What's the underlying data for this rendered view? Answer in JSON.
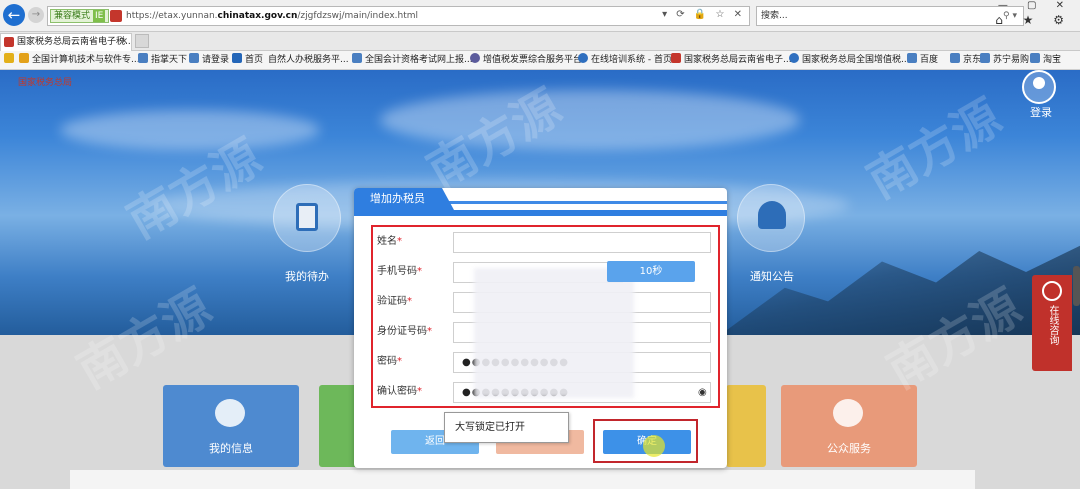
{
  "browser": {
    "mode_label": "兼容模式",
    "mode_badge": "IE",
    "url_prefix": "https://etax.yunnan.",
    "url_domain": "chinatax.gov.cn",
    "url_path": "/zjgfdzswj/main/index.html",
    "url_icons": "▾ ⟳ 🔒 ☆ ✕",
    "search_placeholder": "搜索...",
    "search_icon": "magnifier-icon",
    "window_controls": "—  ▢  ✕",
    "toolbar_icons": "⌂ ★ ⚙",
    "tab_title": "国家税务总局云南省电子税...",
    "tab_close": "✕"
  },
  "favorites": [
    {
      "label": "全国计算机技术与软件专...",
      "color": "#e3a11a"
    },
    {
      "label": "指掌天下",
      "color": "#4a7fc1"
    },
    {
      "label": "请登录",
      "color": "#4a7fc1"
    },
    {
      "label": "首页",
      "color": "#2466b8"
    },
    {
      "label": "自然人办税服务平...",
      "color": "#ffffff"
    },
    {
      "label": "全国会计资格考试网上报...",
      "color": "#4a7fc1"
    },
    {
      "label": "增值税发票综合服务平台",
      "color": "#5b5b9c"
    },
    {
      "label": "在线培训系统 - 首页",
      "color": "#2f6fbf"
    },
    {
      "label": "国家税务总局云南省电子...",
      "color": "#c4362c"
    },
    {
      "label": "国家税务总局全国增值税...",
      "color": "#2f6fbf"
    },
    {
      "label": "百度",
      "color": "#4a7fc1"
    },
    {
      "label": "京东",
      "color": "#4a7fc1"
    },
    {
      "label": "苏宁易购",
      "color": "#4a7fc1"
    },
    {
      "label": "淘宝",
      "color": "#4a7fc1"
    }
  ],
  "page": {
    "logo_text": "国家税务总局",
    "login_label": "登录",
    "my_todo": "我的待办",
    "notice": "通知公告",
    "tiles": [
      {
        "label": "我的信息",
        "color": "#4e8ad0"
      },
      {
        "label": "",
        "color": "#6db85a"
      },
      {
        "label": "",
        "color": "#e8c24a"
      },
      {
        "label": "公众服务",
        "color": "#e89a7a"
      }
    ],
    "online_service": "在线咨询",
    "watermark": "南方源"
  },
  "modal": {
    "title": "增加办税员",
    "fields": [
      {
        "label": "姓名",
        "value": ""
      },
      {
        "label": "手机号码",
        "value": ""
      },
      {
        "label": "验证码",
        "value": ""
      },
      {
        "label": "身份证号码",
        "value": ""
      },
      {
        "label": "密码",
        "value": "●●●●●●●●●●●"
      },
      {
        "label": "确认密码",
        "value": "●●●●●●●●●●●"
      }
    ],
    "required_mark": "*",
    "countdown": "10秒",
    "eye_icon": "eye-icon",
    "capslock_tip": "大写锁定已打开",
    "btn_back": "返回",
    "btn_reset": "",
    "btn_ok": "确定"
  }
}
